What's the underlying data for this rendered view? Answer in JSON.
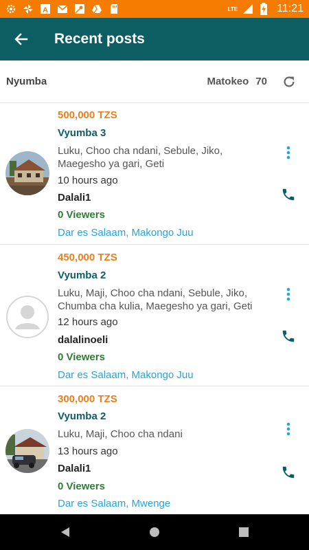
{
  "status_bar": {
    "time": "11:21",
    "network": "LTE",
    "left_icons": [
      "settings-icon",
      "pinwheel-icon",
      "app-a-icon",
      "gmail-icon",
      "maps-icon",
      "drive-icon",
      "sdcard-icon"
    ],
    "right_icons": [
      "signal-icon",
      "battery-charging-icon"
    ],
    "bar_color": "#f57c00"
  },
  "app_bar": {
    "title": "Recent posts",
    "back_icon": "arrow-back-icon",
    "color": "#0d5e63"
  },
  "filter_bar": {
    "category": "Nyumba",
    "results_label": "Matokeo",
    "results_count": "70",
    "refresh_icon": "refresh-icon"
  },
  "posts": [
    {
      "price": "500,000 TZS",
      "type": "Vyumba 3",
      "features": "Luku, Choo cha ndani, Sebule, Jiko, Maegesho ya gari, Geti",
      "time": "10 hours ago",
      "agent": "Dalali1",
      "viewers": "0 Viewers",
      "location": "Dar es Salaam, Makongo Juu",
      "avatar": "house-photo"
    },
    {
      "price": "450,000 TZS",
      "type": "Vyumba 2",
      "features": "Luku, Maji, Choo cha ndani, Sebule, Jiko, Chumba cha kulia, Maegesho ya gari, Geti",
      "time": "12 hours ago",
      "agent": "dalalinoeli",
      "viewers": "0 Viewers",
      "location": "Dar es Salaam, Makongo Juu",
      "avatar": "default-person-placeholder"
    },
    {
      "price": "300,000 TZS",
      "type": "Vyumba 2",
      "features": "Luku, Maji, Choo cha ndani",
      "time": "13 hours ago",
      "agent": "Dalali1",
      "viewers": "0 Viewers",
      "location": "Dar es Salaam, Mwenge",
      "avatar": "house-with-car-photo"
    }
  ],
  "colors": {
    "price": "#ef7d1a",
    "type": "#0d5e63",
    "viewers": "#2e7d32",
    "location": "#29a3dc",
    "action_icon": "#29a3dc",
    "call_icon": "#0d5e63"
  },
  "nav_bar": {
    "buttons": [
      "back-triangle-icon",
      "home-circle-icon",
      "recents-square-icon"
    ]
  }
}
